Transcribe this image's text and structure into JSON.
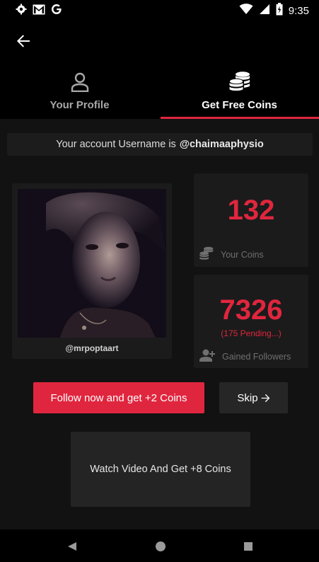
{
  "status_bar": {
    "time": "9:35",
    "left_icons": [
      "gear-icon",
      "gmail-icon",
      "google-g-icon"
    ],
    "right_icons": [
      "wifi-icon",
      "cell-signal-icon",
      "battery-icon"
    ]
  },
  "tabs": [
    {
      "label": "Your Profile",
      "icon": "person-icon",
      "active": false
    },
    {
      "label": "Get Free Coins",
      "icon": "coins-icon",
      "active": true
    }
  ],
  "account_banner": {
    "prefix": "Your account Username is",
    "username": "@chaimaaphysio"
  },
  "profile": {
    "handle": "@mrpoptaart"
  },
  "coins": {
    "value": "132",
    "label": "Your Coins"
  },
  "followers": {
    "value": "7326",
    "pending": "(175 Pending...)",
    "label": "Gained Followers"
  },
  "actions": {
    "follow_label": "Follow now and get +2 Coins",
    "skip_label": "Skip",
    "video_label": "Watch Video And Get +8 Coins"
  },
  "colors": {
    "accent": "#e0263e",
    "background": "#121212",
    "card": "#1b1b1b"
  }
}
